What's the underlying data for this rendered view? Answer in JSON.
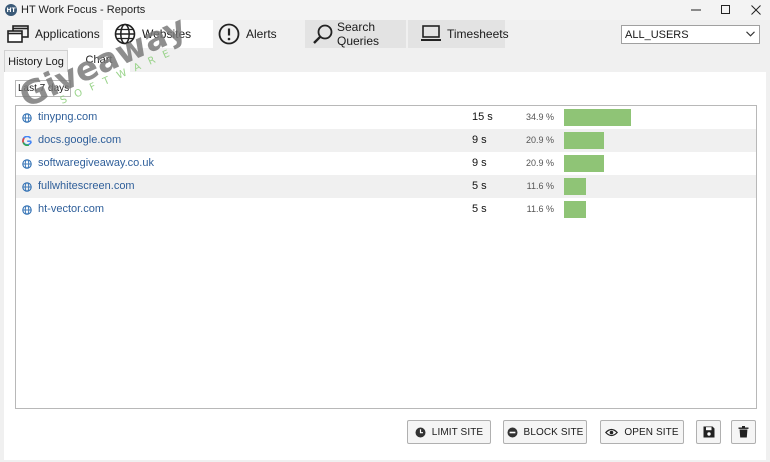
{
  "window": {
    "title": "HT Work Focus - Reports",
    "app_icon_text": "HT"
  },
  "main_tabs": [
    {
      "label": "Applications",
      "icon": "stacked-windows-icon"
    },
    {
      "label": "Websites",
      "icon": "globe-icon",
      "active": true
    },
    {
      "label": "Alerts",
      "icon": "alert-circle-icon"
    },
    {
      "label": "Search Queries",
      "icon": "magnifier-icon"
    },
    {
      "label": "Timesheets",
      "icon": "laptop-icon"
    }
  ],
  "user_filter": {
    "selected": "ALL_USERS"
  },
  "sub_tabs": [
    {
      "label": "History Log"
    },
    {
      "label": "Chart",
      "active": true
    }
  ],
  "period_filter": {
    "selected": "Last 7 days"
  },
  "sites": [
    {
      "site": "tinypng.com",
      "time": "15 s",
      "percent_label": "34.9 %",
      "share": 0.349,
      "favicon": "globe-icon"
    },
    {
      "site": "docs.google.com",
      "time": "9 s",
      "percent_label": "20.9 %",
      "share": 0.209,
      "favicon": "google-icon"
    },
    {
      "site": "softwaregiveaway.co.uk",
      "time": "9 s",
      "percent_label": "20.9 %",
      "share": 0.209,
      "favicon": "globe-icon"
    },
    {
      "site": "fullwhitescreen.com",
      "time": "5 s",
      "percent_label": "11.6 %",
      "share": 0.116,
      "favicon": "globe-icon"
    },
    {
      "site": "ht-vector.com",
      "time": "5 s",
      "percent_label": "11.6 %",
      "share": 0.116,
      "favicon": "globe-icon"
    }
  ],
  "actions": {
    "limit_label": "LIMIT SITE",
    "block_label": "BLOCK SITE",
    "open_label": "OPEN SITE"
  },
  "watermark": {
    "main": "Giveaway",
    "sub": "SOFTWARE"
  },
  "colors": {
    "bar": "#8fc476",
    "link": "#2f5f9a",
    "alt_row": "#f0f0f0",
    "watermark": "#7a7a7a"
  }
}
